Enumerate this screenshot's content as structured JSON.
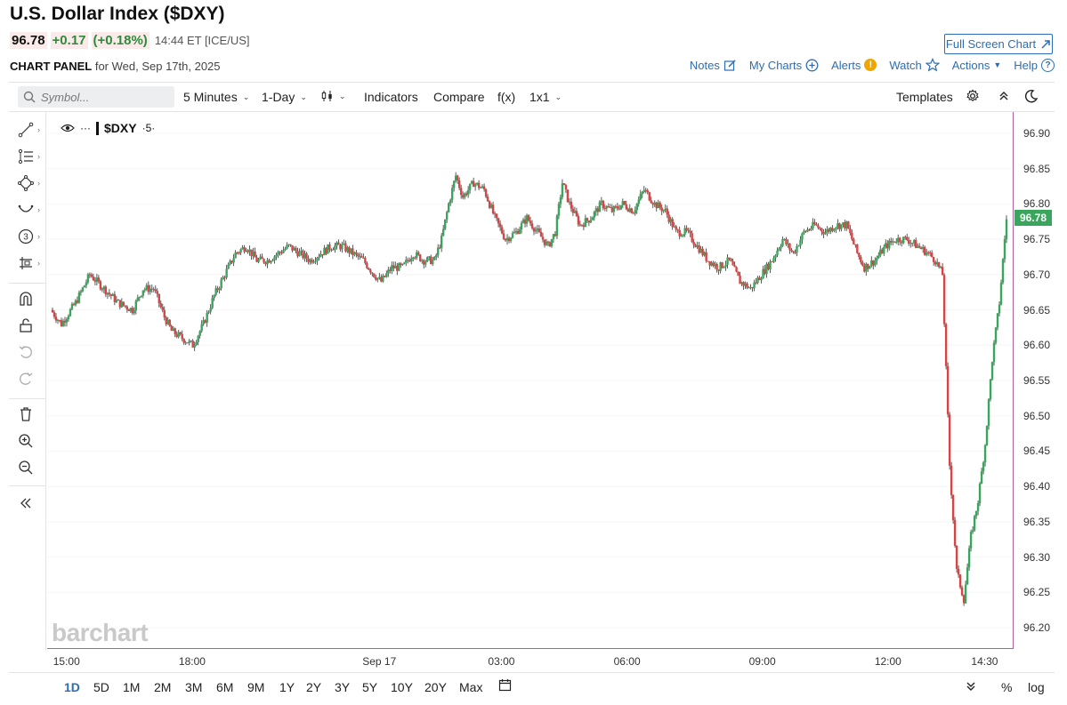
{
  "header": {
    "title": "U.S. Dollar Index ($DXY)",
    "price": "96.78",
    "change": "+0.17",
    "change_pct": "(+0.18%)",
    "time": "14:44 ET [ICE/US]",
    "panel_label": "CHART PANEL",
    "panel_date": "for Wed, Sep 17th, 2025",
    "fullscreen_label": "Full Screen Chart"
  },
  "top_links": {
    "notes": "Notes",
    "my_charts": "My Charts",
    "alerts": "Alerts",
    "watch": "Watch",
    "actions": "Actions",
    "help": "Help"
  },
  "toolbar": {
    "symbol_placeholder": "Symbol...",
    "interval": "5 Minutes",
    "period": "1-Day",
    "indicators": "Indicators",
    "compare": "Compare",
    "fx": "f(x)",
    "layout": "1x1",
    "templates": "Templates"
  },
  "legend": {
    "symbol": "$DXY",
    "interval": "·5·"
  },
  "watermark": "barchart",
  "y_axis": [
    "96.90",
    "96.85",
    "96.80",
    "96.75",
    "96.70",
    "96.65",
    "96.60",
    "96.55",
    "96.50",
    "96.45",
    "96.40",
    "96.35",
    "96.30",
    "96.25",
    "96.20"
  ],
  "last_price_tag": "96.78",
  "x_axis": [
    "15:00",
    "18:00",
    "Sep 17",
    "03:00",
    "06:00",
    "09:00",
    "12:00",
    "14:30"
  ],
  "ranges": [
    "1D",
    "5D",
    "1M",
    "2M",
    "3M",
    "6M",
    "9M",
    "1Y",
    "2Y",
    "3Y",
    "5Y",
    "10Y",
    "20Y",
    "Max"
  ],
  "bottom_right": {
    "percent": "%",
    "log": "log"
  },
  "colors": {
    "up": "#3aa55c",
    "down": "#d64545",
    "accent": "#2d6db5"
  },
  "chart_data": {
    "type": "candlestick",
    "symbol": "$DXY",
    "interval": "5 Minutes",
    "ylim": [
      96.17,
      96.93
    ],
    "y_ticks": [
      96.2,
      96.25,
      96.3,
      96.35,
      96.4,
      96.45,
      96.5,
      96.55,
      96.6,
      96.65,
      96.7,
      96.75,
      96.8,
      96.85,
      96.9
    ],
    "last": 96.78,
    "close_path": [
      [
        0,
        96.65
      ],
      [
        6,
        96.63
      ],
      [
        14,
        96.66
      ],
      [
        22,
        96.7
      ],
      [
        30,
        96.68
      ],
      [
        38,
        96.66
      ],
      [
        46,
        96.65
      ],
      [
        52,
        96.68
      ],
      [
        58,
        96.68
      ],
      [
        64,
        96.64
      ],
      [
        68,
        96.62
      ],
      [
        74,
        96.61
      ],
      [
        80,
        96.6
      ],
      [
        86,
        96.63
      ],
      [
        92,
        96.67
      ],
      [
        98,
        96.7
      ],
      [
        104,
        96.73
      ],
      [
        110,
        96.74
      ],
      [
        116,
        96.72
      ],
      [
        122,
        96.72
      ],
      [
        128,
        96.73
      ],
      [
        134,
        96.74
      ],
      [
        140,
        96.73
      ],
      [
        146,
        96.72
      ],
      [
        152,
        96.73
      ],
      [
        158,
        96.74
      ],
      [
        164,
        96.74
      ],
      [
        170,
        96.73
      ],
      [
        176,
        96.72
      ],
      [
        182,
        96.7
      ],
      [
        186,
        96.69
      ],
      [
        192,
        96.71
      ],
      [
        198,
        96.71
      ],
      [
        204,
        96.73
      ],
      [
        210,
        96.72
      ],
      [
        216,
        96.72
      ],
      [
        220,
        96.75
      ],
      [
        224,
        96.8
      ],
      [
        228,
        96.84
      ],
      [
        232,
        96.81
      ],
      [
        238,
        96.83
      ],
      [
        244,
        96.82
      ],
      [
        250,
        96.78
      ],
      [
        256,
        96.75
      ],
      [
        262,
        96.76
      ],
      [
        268,
        96.78
      ],
      [
        274,
        96.76
      ],
      [
        280,
        96.74
      ],
      [
        284,
        96.76
      ],
      [
        288,
        96.83
      ],
      [
        292,
        96.8
      ],
      [
        298,
        96.77
      ],
      [
        304,
        96.78
      ],
      [
        310,
        96.8
      ],
      [
        316,
        96.79
      ],
      [
        322,
        96.8
      ],
      [
        328,
        96.79
      ],
      [
        334,
        96.82
      ],
      [
        340,
        96.8
      ],
      [
        346,
        96.79
      ],
      [
        352,
        96.76
      ],
      [
        358,
        96.76
      ],
      [
        364,
        96.74
      ],
      [
        370,
        96.72
      ],
      [
        376,
        96.71
      ],
      [
        382,
        96.72
      ],
      [
        388,
        96.69
      ],
      [
        394,
        96.68
      ],
      [
        400,
        96.7
      ],
      [
        406,
        96.72
      ],
      [
        412,
        96.75
      ],
      [
        418,
        96.73
      ],
      [
        424,
        96.76
      ],
      [
        430,
        96.77
      ],
      [
        436,
        96.76
      ],
      [
        442,
        96.77
      ],
      [
        448,
        96.77
      ],
      [
        454,
        96.73
      ],
      [
        458,
        96.71
      ],
      [
        464,
        96.72
      ],
      [
        470,
        96.74
      ],
      [
        476,
        96.75
      ],
      [
        482,
        96.75
      ],
      [
        488,
        96.74
      ],
      [
        494,
        96.73
      ],
      [
        498,
        96.72
      ],
      [
        502,
        96.7
      ],
      [
        506,
        96.43
      ],
      [
        510,
        96.28
      ],
      [
        514,
        96.24
      ],
      [
        518,
        96.33
      ],
      [
        522,
        96.38
      ],
      [
        526,
        96.46
      ],
      [
        530,
        96.58
      ],
      [
        534,
        96.66
      ],
      [
        538,
        96.78
      ]
    ],
    "x_tick_positions": [
      0.02,
      0.15,
      0.34,
      0.47,
      0.6,
      0.74,
      0.87,
      0.97
    ]
  }
}
